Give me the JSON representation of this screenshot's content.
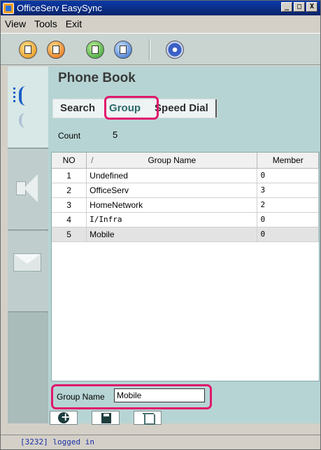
{
  "window": {
    "title": "OfficeServ EasySync",
    "controls": [
      "_",
      "□",
      "X"
    ]
  },
  "menu": {
    "items": [
      "View",
      "Tools",
      "Exit"
    ]
  },
  "toolbar": {
    "icons": [
      "download-icon",
      "download-all-icon",
      "upload-icon",
      "upload-all-icon",
      "settings-icon"
    ]
  },
  "sidenav": {
    "items": [
      "phone-book",
      "sound",
      "mail"
    ]
  },
  "main": {
    "title": "Phone Book",
    "tabs": [
      "Search",
      "Group",
      "Speed Dial"
    ],
    "active_tab": "Group",
    "count_label": "Count",
    "count_value": "5",
    "table": {
      "headers": {
        "no": "NO",
        "sort": "/",
        "name": "Group Name",
        "member": "Member"
      },
      "rows": [
        {
          "no": "1",
          "name": "Undefined",
          "member": "0"
        },
        {
          "no": "2",
          "name": "OfficeServ",
          "member": "3"
        },
        {
          "no": "3",
          "name": "HomeNetwork",
          "member": "2"
        },
        {
          "no": "4",
          "name": "I/Infra",
          "member": "0"
        },
        {
          "no": "5",
          "name": "Mobile",
          "member": "0"
        }
      ]
    },
    "group_name_label": "Group Name",
    "group_name_value": "Mobile"
  },
  "status": {
    "text": "[3232] logged in"
  },
  "colors": {
    "highlight": "#e0186c",
    "panel": "#b7d4d4",
    "titlebar": "#0a246a"
  }
}
